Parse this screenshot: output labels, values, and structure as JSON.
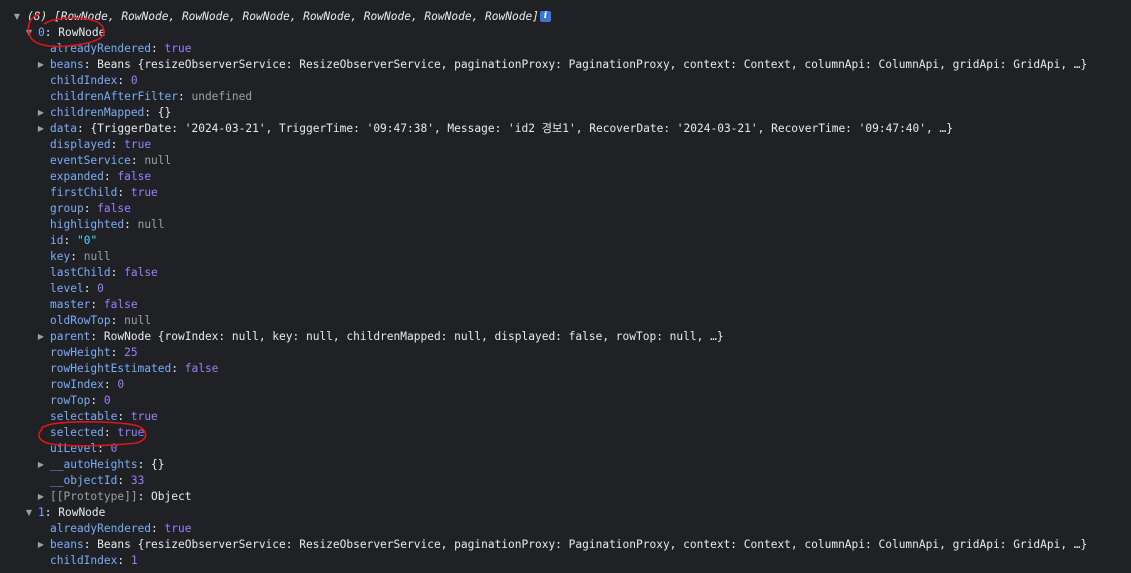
{
  "array_header": {
    "count_label": "(8)",
    "items_label": "[RowNode, RowNode, RowNode, RowNode, RowNode, RowNode, RowNode, RowNode]"
  },
  "info_icon": "info-icon",
  "node0": {
    "label": "0",
    "type": "RowNode",
    "props": {
      "alreadyRendered": "true",
      "beans_key": "beans",
      "beans_preview": "Beans {resizeObserverService: ResizeObserverService, paginationProxy: PaginationProxy, context: Context, columnApi: ColumnApi, gridApi: GridApi, …}",
      "childIndex": "0",
      "childrenAfterFilter": "undefined",
      "childrenMapped": "{}",
      "data_preview": "{TriggerDate: '2024-03-21', TriggerTime: '09:47:38', Message: 'id2 경보1', RecoverDate: '2024-03-21', RecoverTime: '09:47:40', …}",
      "displayed": "true",
      "eventService": "null",
      "expanded": "false",
      "firstChild": "true",
      "group": "false",
      "highlighted": "null",
      "id": "\"0\"",
      "key": "null",
      "lastChild": "false",
      "level": "0",
      "master": "false",
      "oldRowTop": "null",
      "parent_preview": "RowNode {rowIndex: null, key: null, childrenMapped: null, displayed: false, rowTop: null, …}",
      "rowHeight": "25",
      "rowHeightEstimated": "false",
      "rowIndex": "0",
      "rowTop": "0",
      "selectable": "true",
      "selected": "true",
      "uiLevel": "0",
      "autoHeights": "{}",
      "objectId": "33",
      "prototype_label": "[[Prototype]]",
      "prototype_value": "Object"
    }
  },
  "node1": {
    "label": "1",
    "type": "RowNode",
    "props": {
      "alreadyRendered": "true",
      "beans_preview": "Beans {resizeObserverService: ResizeObserverService, paginationProxy: PaginationProxy, context: Context, columnApi: ColumnApi, gridApi: GridApi, …}",
      "childIndex": "1"
    }
  },
  "annotation_color": "#e0151b"
}
